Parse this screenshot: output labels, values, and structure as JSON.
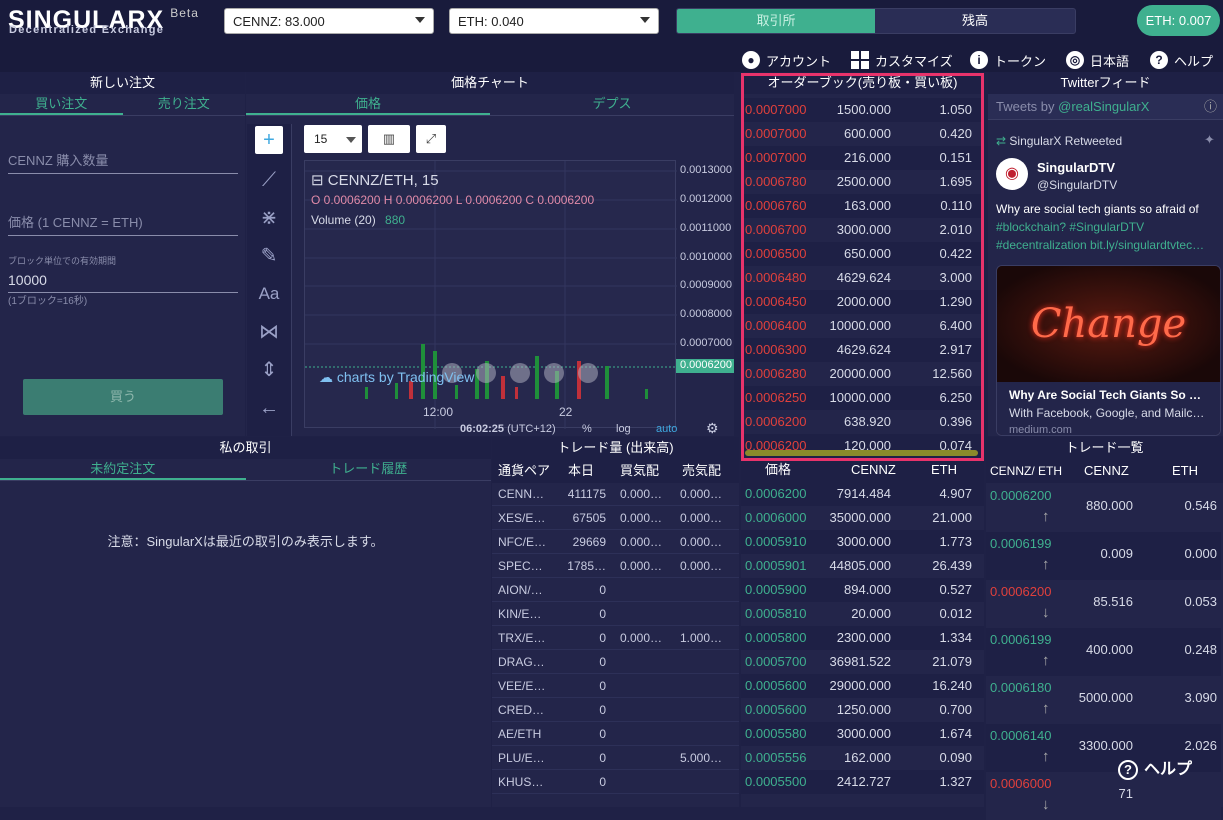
{
  "header": {
    "logo": "SINGULARX",
    "beta": "Beta",
    "subtitle": "Decentralized Exchange",
    "token_select": "CENNZ: 83.000",
    "eth_select": "ETH: 0.040",
    "toggle": [
      "取引所",
      "残高"
    ],
    "eth_balance": "ETH: 0.007"
  },
  "nav": [
    "アカウント",
    "カスタマイズ",
    "トークン",
    "日本語",
    "ヘルプ"
  ],
  "order": {
    "title": "新しい注文",
    "tabs": [
      "買い注文",
      "売り注文"
    ],
    "qty_placeholder": "CENNZ 購入数量",
    "price_placeholder": "価格 (1 CENNZ = ETH)",
    "expiry_label": "ブロック単位での有効期間",
    "expiry_value": "10000",
    "expiry_note": "(1ブロック=16秒)",
    "buy_button": "買う"
  },
  "chart": {
    "title": "価格チャート",
    "tabs": [
      "価格",
      "デプス"
    ],
    "interval": "15",
    "symbol": "CENNZ/ETH, 15",
    "ohlc": "O 0.0006200 H 0.0006200 L 0.0006200 C 0.0006200",
    "volume_label": "Volume (20)",
    "volume_value": "880",
    "watermark": "charts by TradingView",
    "xticks": [
      "12:00",
      "22"
    ],
    "yticks": [
      "0.0013000",
      "0.0012000",
      "0.0011000",
      "0.0010000",
      "0.0009000",
      "0.0008000",
      "0.0007000"
    ],
    "last_price": "0.0006200",
    "time": "06:02:25",
    "tz": "(UTC+12)",
    "opts": [
      "%",
      "log",
      "auto"
    ]
  },
  "orderbook": {
    "title": "オーダーブック(売り板・買い板)",
    "sells": [
      [
        "0.0007000",
        "1500.000",
        "1.050"
      ],
      [
        "0.0007000",
        "600.000",
        "0.420"
      ],
      [
        "0.0007000",
        "216.000",
        "0.151"
      ],
      [
        "0.0006780",
        "2500.000",
        "1.695"
      ],
      [
        "0.0006760",
        "163.000",
        "0.110"
      ],
      [
        "0.0006700",
        "3000.000",
        "2.010"
      ],
      [
        "0.0006500",
        "650.000",
        "0.422"
      ],
      [
        "0.0006480",
        "4629.624",
        "3.000"
      ],
      [
        "0.0006450",
        "2000.000",
        "1.290"
      ],
      [
        "0.0006400",
        "10000.000",
        "6.400"
      ],
      [
        "0.0006300",
        "4629.624",
        "2.917"
      ],
      [
        "0.0006280",
        "20000.000",
        "12.560"
      ],
      [
        "0.0006250",
        "10000.000",
        "6.250"
      ],
      [
        "0.0006200",
        "638.920",
        "0.396"
      ],
      [
        "0.0006200",
        "120.000",
        "0.074"
      ]
    ],
    "headers": [
      "価格",
      "CENNZ",
      "ETH"
    ],
    "buys": [
      [
        "0.0006200",
        "7914.484",
        "4.907"
      ],
      [
        "0.0006000",
        "35000.000",
        "21.000"
      ],
      [
        "0.0005910",
        "3000.000",
        "1.773"
      ],
      [
        "0.0005901",
        "44805.000",
        "26.439"
      ],
      [
        "0.0005900",
        "894.000",
        "0.527"
      ],
      [
        "0.0005810",
        "20.000",
        "0.012"
      ],
      [
        "0.0005800",
        "2300.000",
        "1.334"
      ],
      [
        "0.0005700",
        "36981.522",
        "21.079"
      ],
      [
        "0.0005600",
        "29000.000",
        "16.240"
      ],
      [
        "0.0005600",
        "1250.000",
        "0.700"
      ],
      [
        "0.0005580",
        "3000.000",
        "1.674"
      ],
      [
        "0.0005556",
        "162.000",
        "0.090"
      ],
      [
        "0.0005500",
        "2412.727",
        "1.327"
      ]
    ]
  },
  "twitter": {
    "title": "Twitterフィード",
    "by": "Tweets by",
    "handle": "@realSingularX",
    "retweeted": "SingularX Retweeted",
    "user": "SingularDTV",
    "user_handle": "@SingularDTV",
    "text1": "Why are social tech giants so afraid of",
    "text2": "#blockchain? #SingularDTV",
    "text3": "#decentralization bit.ly/singulardtvtec…",
    "card_img": "Change",
    "card_title": "Why Are Social Tech Giants So …",
    "card_sub": "With Facebook, Google, and Mailc…",
    "card_domain": "medium.com"
  },
  "mytrades": {
    "title": "私の取引",
    "tabs": [
      "未約定注文",
      "トレード履歴"
    ],
    "note": "注意：SingularXは最近の取引のみ表示します。"
  },
  "volume": {
    "title": "トレード量 (出来高)",
    "headers": [
      "通貨ペア",
      "本日",
      "買気配",
      "売気配"
    ],
    "rows": [
      [
        "CENN…",
        "411175",
        "0.000…",
        "0.000…"
      ],
      [
        "XES/E…",
        "67505",
        "0.000…",
        "0.000…"
      ],
      [
        "NFC/E…",
        "29669",
        "0.000…",
        "0.000…"
      ],
      [
        "SPEC…",
        "1785…",
        "0.000…",
        "0.000…"
      ],
      [
        "AION/…",
        "0",
        "",
        ""
      ],
      [
        "KIN/E…",
        "0",
        "",
        ""
      ],
      [
        "TRX/E…",
        "0",
        "0.000…",
        "1.000…"
      ],
      [
        "DRAG…",
        "0",
        "",
        ""
      ],
      [
        "VEE/E…",
        "0",
        "",
        ""
      ],
      [
        "CRED…",
        "0",
        "",
        ""
      ],
      [
        "AE/ETH",
        "0",
        "",
        ""
      ],
      [
        "PLU/E…",
        "0",
        "",
        "5.000…"
      ],
      [
        "KHUS…",
        "0",
        "",
        ""
      ]
    ]
  },
  "trades": {
    "title": "トレード一覧",
    "headers": [
      "CENNZ/ ETH",
      "CENNZ",
      "ETH"
    ],
    "rows": [
      [
        "0.0006200",
        "880.000",
        "0.546",
        "up"
      ],
      [
        "0.0006199",
        "0.009",
        "0.000",
        "up"
      ],
      [
        "0.0006200",
        "85.516",
        "0.053",
        "down"
      ],
      [
        "0.0006199",
        "400.000",
        "0.248",
        "up"
      ],
      [
        "0.0006180",
        "5000.000",
        "3.090",
        "up"
      ],
      [
        "0.0006140",
        "3300.000",
        "2.026",
        "up"
      ],
      [
        "0.0006000",
        "71",
        "",
        "down"
      ]
    ]
  },
  "help_button": "ヘルプ",
  "colors": {
    "accent": "#3fb08f",
    "sell": "#e0403c",
    "highlight": "#e8336b"
  }
}
